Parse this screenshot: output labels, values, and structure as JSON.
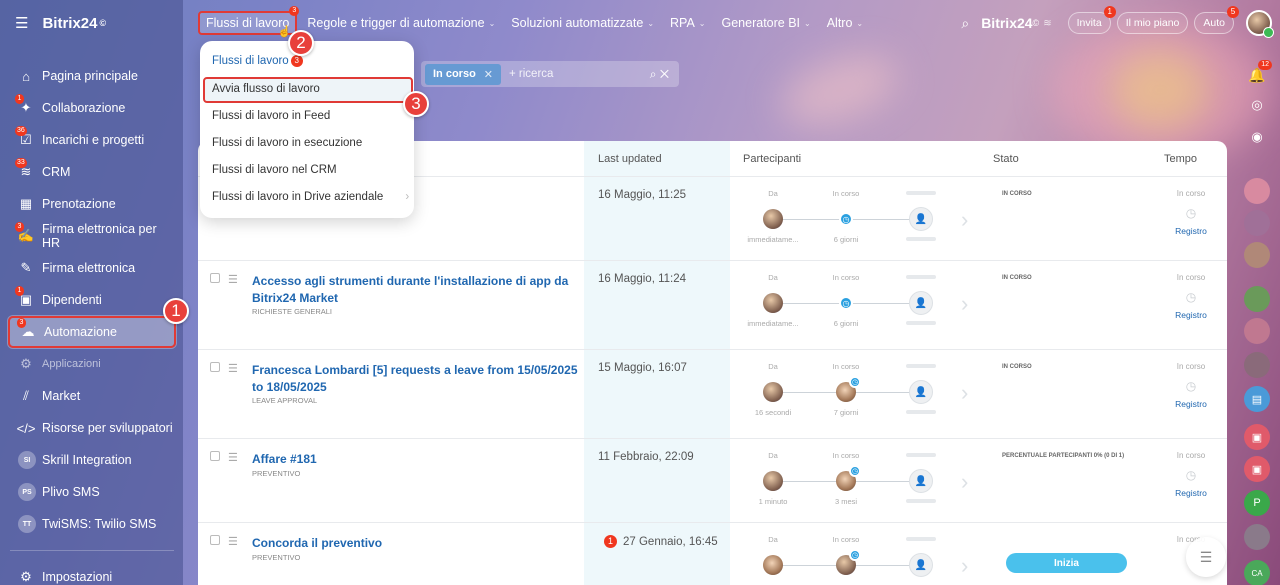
{
  "sidebar": {
    "logo": "Bitrix24",
    "logo_mark": "©",
    "items": [
      {
        "label": "Pagina principale",
        "badge": "",
        "icon": "home-icon"
      },
      {
        "label": "Collaborazione",
        "badge": "1",
        "icon": "chat-icon"
      },
      {
        "label": "Incarichi e progetti",
        "badge": "36",
        "icon": "tasks-icon"
      },
      {
        "label": "CRM",
        "badge": "33",
        "icon": "crm-icon"
      },
      {
        "label": "Prenotazione",
        "badge": "",
        "icon": "calendar-icon"
      },
      {
        "label": "Firma elettronica per HR",
        "badge": "3",
        "icon": "sign-hr-icon"
      },
      {
        "label": "Firma elettronica",
        "badge": "",
        "icon": "pen-icon"
      },
      {
        "label": "Dipendenti",
        "badge": "1",
        "icon": "employees-icon"
      },
      {
        "label": "Automazione",
        "badge": "3",
        "icon": "automation-icon"
      },
      {
        "label": "Applicazioni",
        "badge": "",
        "icon": "apps-icon"
      },
      {
        "label": "Market",
        "badge": "",
        "icon": "market-icon"
      },
      {
        "label": "Risorse per sviluppatori",
        "badge": "",
        "icon": "code-icon"
      },
      {
        "label": "Skrill Integration",
        "avatar": "SI"
      },
      {
        "label": "Plivo SMS",
        "avatar": "PS"
      },
      {
        "label": "TwiSMS: Twilio SMS",
        "avatar": "TT"
      }
    ],
    "settings": "Impostazioni"
  },
  "topbar": {
    "menu": [
      {
        "label": "Flussi di lavoro",
        "badge": "3"
      },
      {
        "label": "Regole e trigger di automazione"
      },
      {
        "label": "Soluzioni automatizzate"
      },
      {
        "label": "RPA"
      },
      {
        "label": "Generatore BI"
      },
      {
        "label": "Altro"
      }
    ],
    "brand": "Bitrix24",
    "brand_mark": "©",
    "invite": "Invita",
    "invite_badge": "1",
    "plan": "Il mio piano",
    "auto": "Auto",
    "auto_badge": "5",
    "notif_badge": "12"
  },
  "callouts": [
    "1",
    "2",
    "3"
  ],
  "dropdown": {
    "items": [
      {
        "label": "Flussi di lavoro",
        "badge": "3"
      },
      {
        "label": "Avvia flusso di lavoro"
      },
      {
        "label": "Flussi di lavoro in Feed"
      },
      {
        "label": "Flussi di lavoro in esecuzione"
      },
      {
        "label": "Flussi di lavoro nel CRM"
      },
      {
        "label": "Flussi di lavoro in Drive aziendale"
      }
    ]
  },
  "filter": {
    "chip": "In corso",
    "placeholder": "+ ricerca"
  },
  "table": {
    "headers": {
      "updated": "Last updated",
      "participants": "Partecipanti",
      "status": "Stato",
      "time": "Tempo"
    },
    "part_labels": {
      "from": "Da",
      "running": "In corso"
    },
    "tempo_label": "In corso",
    "log_link": "Registro",
    "rows": [
      {
        "title": "",
        "sub": "",
        "date": "16 Maggio, 11:25",
        "date_badge": "",
        "from_time": "immediatame...",
        "run_time": "6 giorni",
        "status": "IN CORSO"
      },
      {
        "title": "Accesso agli strumenti durante l'installazione di app da Bitrix24 Market",
        "sub": "RICHIESTE GENERALI",
        "date": "16 Maggio, 11:24",
        "date_badge": "",
        "from_time": "immediatame...",
        "run_time": "6 giorni",
        "status": "IN CORSO"
      },
      {
        "title": "Francesca Lombardi [5] requests a leave from 15/05/2025 to 18/05/2025",
        "sub": "LEAVE APPROVAL",
        "date": "15 Maggio, 16:07",
        "date_badge": "",
        "from_time": "16 secondi",
        "run_time": "7 giorni",
        "status": "IN CORSO"
      },
      {
        "title": "Affare #181",
        "sub": "PREVENTIVO",
        "date": "11 Febbraio, 22:09",
        "date_badge": "",
        "from_time": "1 minuto",
        "run_time": "3 mesi",
        "status": "PERCENTUALE PARTECIPANTI 0% (0 DI 1)"
      },
      {
        "title": "Concorda il preventivo",
        "sub": "PREVENTIVO",
        "date": "27 Gennaio, 16:45",
        "date_badge": "1",
        "from_time": "",
        "run_time": "",
        "status": "",
        "action": "Inizia"
      }
    ]
  },
  "rail": {
    "notif_badge": "12",
    "bottom_avatar": "CA"
  }
}
